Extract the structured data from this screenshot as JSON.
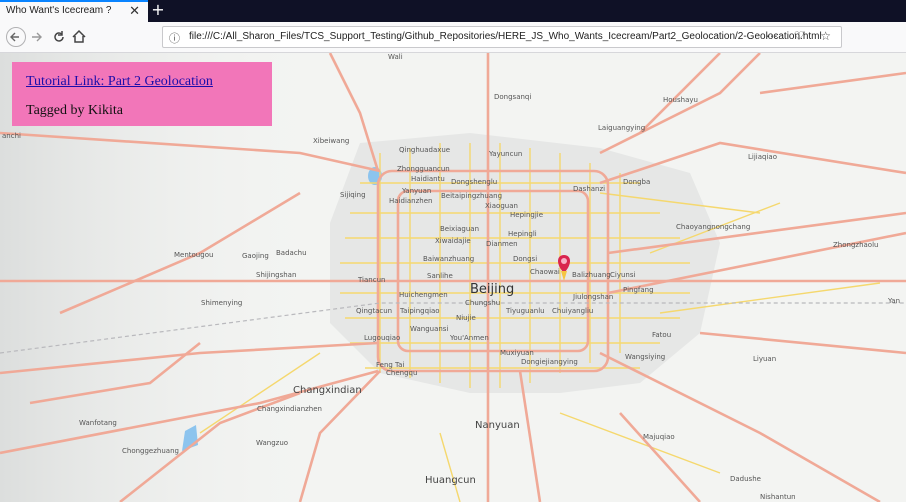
{
  "browser": {
    "tab_title": "Who Want's Icecream ?",
    "tab_close": "✕",
    "new_tab": "+",
    "url": "file:///C:/All_Sharon_Files/TCS_Support_Testing/Github_Repositories/HERE_JS_Who_Wants_Icecream/Part2_Geolocation/2-Geolocation.html",
    "page_actions": "⋯ ♡ ☆"
  },
  "panel": {
    "link": "Tutorial Link: Part 2 Geolocation",
    "tag": "Tagged by Kikita"
  },
  "map": {
    "labels": [
      {
        "text": "Beijing",
        "size": "big"
      },
      {
        "text": "Changxindian",
        "size": "mid"
      },
      {
        "text": "Nanyuan",
        "size": "mid"
      },
      {
        "text": "Huangcun",
        "size": "mid"
      },
      {
        "text": "Dongsanqi"
      },
      {
        "text": "Houshayu"
      },
      {
        "text": "Laiguangying"
      },
      {
        "text": "Lijiaqiao"
      },
      {
        "text": "Xibeiwang"
      },
      {
        "text": "Qinghuadaxue"
      },
      {
        "text": "Yayuncun"
      },
      {
        "text": "Zhongguancun"
      },
      {
        "text": "Haidiantu"
      },
      {
        "text": "Dongshenglu"
      },
      {
        "text": "Dashanzi"
      },
      {
        "text": "Dongba"
      },
      {
        "text": "Sijiqing"
      },
      {
        "text": "Yanyuan"
      },
      {
        "text": "Beitaipingzhuang"
      },
      {
        "text": "Haidianzhen"
      },
      {
        "text": "Xiaoguan"
      },
      {
        "text": "Hepingjie"
      },
      {
        "text": "Chaoyangnongchang"
      },
      {
        "text": "Beixiaguan"
      },
      {
        "text": "Hepingli"
      },
      {
        "text": "Xiwaidajie"
      },
      {
        "text": "Dianmen"
      },
      {
        "text": "Mentougou"
      },
      {
        "text": "Gaojing"
      },
      {
        "text": "Badachu"
      },
      {
        "text": "Baiwanzhuang"
      },
      {
        "text": "Dongsi"
      },
      {
        "text": "Shijingshan"
      },
      {
        "text": "Sanlihe"
      },
      {
        "text": "Chaowai"
      },
      {
        "text": "Balizhuang"
      },
      {
        "text": "Ciyunsi"
      },
      {
        "text": "Zhongzhaolu"
      },
      {
        "text": "Tiancun"
      },
      {
        "text": "Pingfang"
      },
      {
        "text": "Huichengmen"
      },
      {
        "text": "Jiulongshan"
      },
      {
        "text": "Shimenying"
      },
      {
        "text": "Chungshu"
      },
      {
        "text": "Qingtacun"
      },
      {
        "text": "Taipingqiao"
      },
      {
        "text": "Niujie"
      },
      {
        "text": "Tiyuguanlu"
      },
      {
        "text": "Chuiyangliu"
      },
      {
        "text": "Wanguansi"
      },
      {
        "text": "Fatou"
      },
      {
        "text": "Lugouqiao"
      },
      {
        "text": "You'Anmen"
      },
      {
        "text": "Muxiyuan"
      },
      {
        "text": "Wangsiying"
      },
      {
        "text": "Liyuan"
      },
      {
        "text": "Dongiejiangying"
      },
      {
        "text": "Feng Tai"
      },
      {
        "text": "Chengqu"
      },
      {
        "text": "Changxindianzhen"
      },
      {
        "text": "Wanfotang"
      },
      {
        "text": "Wangzuo"
      },
      {
        "text": "Chonggezhuang"
      },
      {
        "text": "Majuqiao"
      },
      {
        "text": "Dadushe"
      },
      {
        "text": "Wali"
      },
      {
        "text": "Yan"
      },
      {
        "text": "anchi"
      },
      {
        "text": "Nishantun"
      }
    ],
    "marker_icon": "map-pin-icon"
  },
  "colors": {
    "panel": "#f276b9",
    "link": "#1a0dab",
    "major_road": "#f0a997",
    "minor_road": "#f5d86e",
    "tab_accent": "#0a84ff"
  }
}
